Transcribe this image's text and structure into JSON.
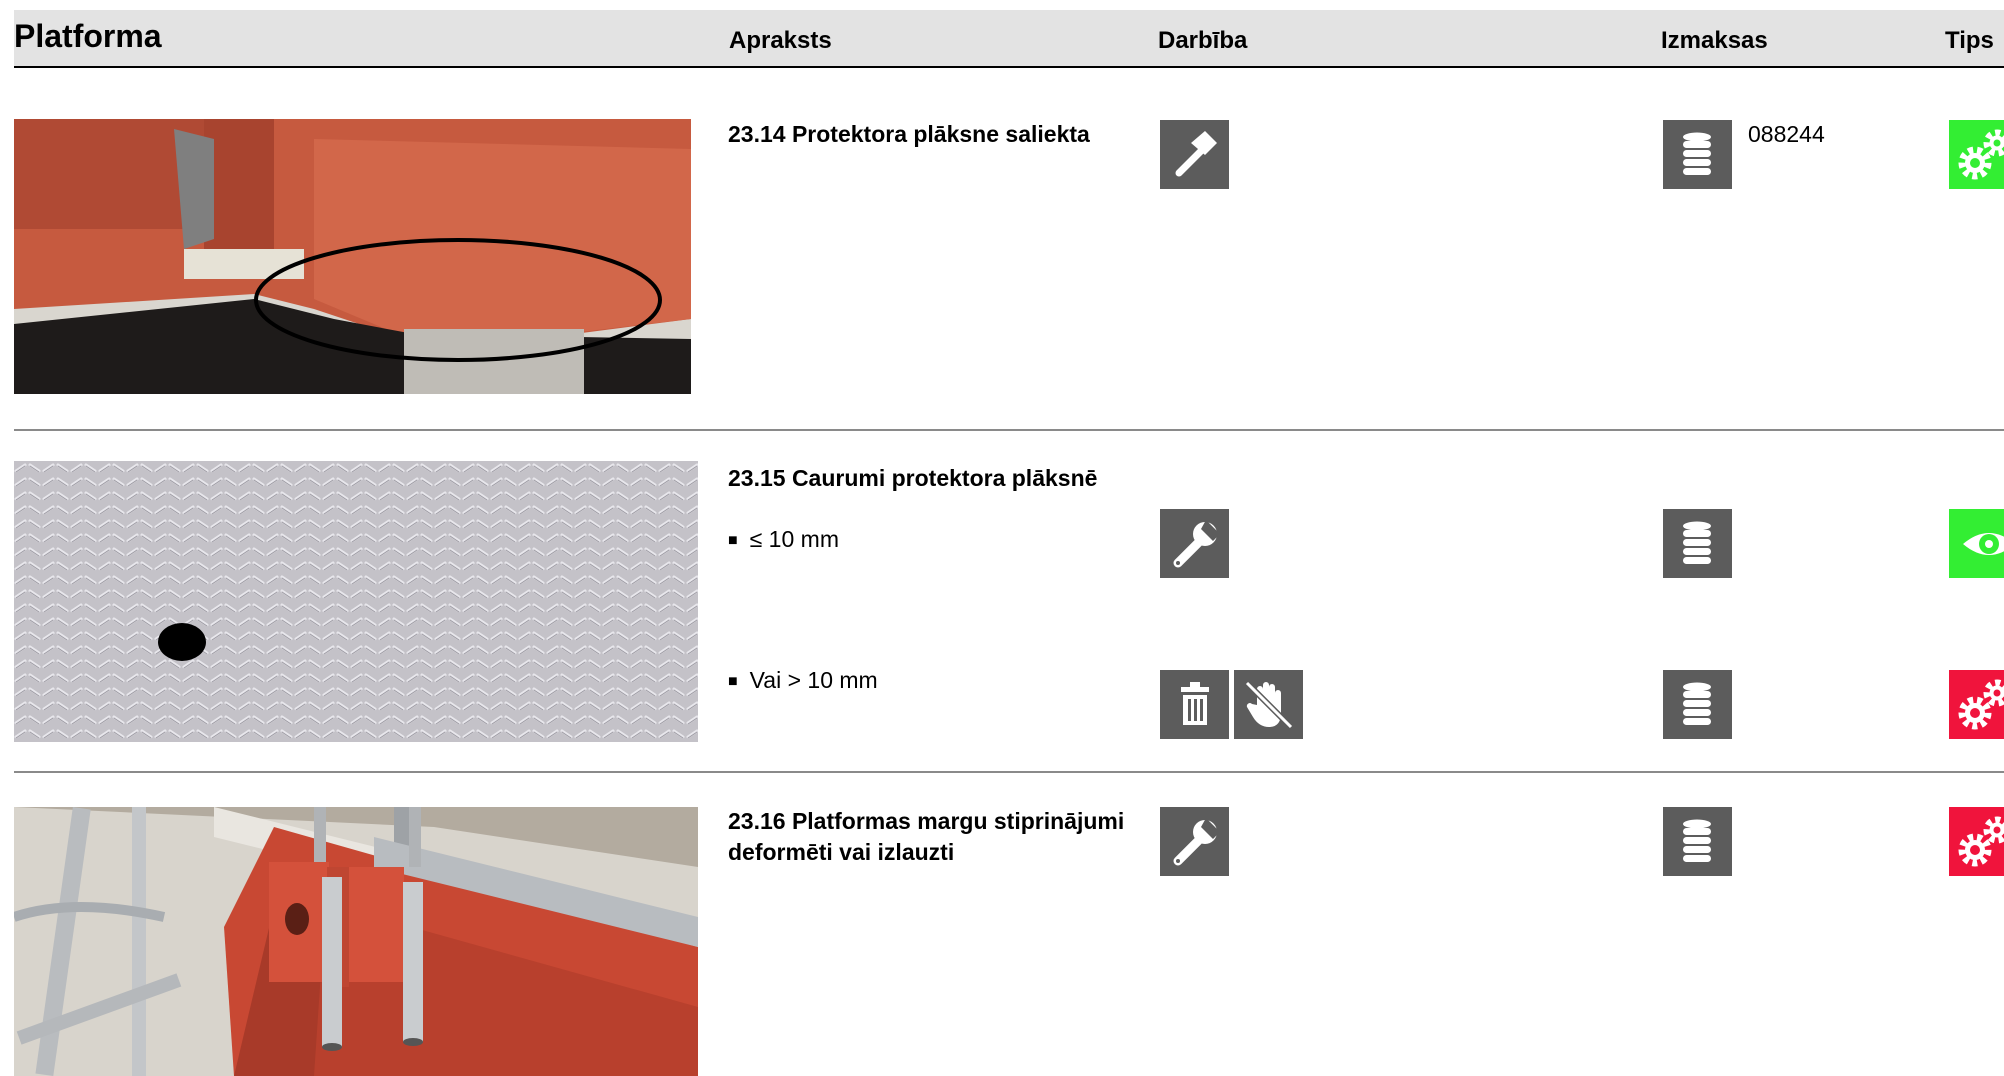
{
  "header": {
    "title": "Platforma",
    "col_description": "Apraksts",
    "col_action": "Darbība",
    "col_cost": "Izmaksas",
    "col_tip": "Tips"
  },
  "rows": [
    {
      "title": "23.14 Protektora plāksne saliekta",
      "photo": "bent-tread-plate-photo",
      "action_icons": [
        "hammer-icon"
      ],
      "cost_value": "088244",
      "tip_icon": "gears-icon",
      "tip_color": "#33ee33"
    },
    {
      "title": "23.15 Caurumi protektora plāksnē",
      "photo": "tread-plate-hole-photo",
      "options": [
        {
          "label": "≤ 10 mm",
          "action_icons": [
            "wrench-icon"
          ],
          "tip_icon": "eye-icon",
          "tip_color": "#33ee33"
        },
        {
          "label": "Vai > 10 mm",
          "action_icons": [
            "trash-icon",
            "no-hand-icon"
          ],
          "tip_icon": "gears-icon",
          "tip_color": "#f0143c"
        }
      ]
    },
    {
      "title_line1": "23.16 Platformas margu stiprinājumi",
      "title_line2": "deformēti vai izlauzti",
      "photo": "railing-mount-photo",
      "action_icons": [
        "wrench-icon"
      ],
      "tip_icon": "gears-icon",
      "tip_color": "#f0143c"
    }
  ],
  "icons": {
    "cost": "coins-icon"
  },
  "colors": {
    "icon_bg": "#5c5c5c",
    "header_bg": "#e3e3e3",
    "ok_green": "#33ee33",
    "replace_red": "#f0143c"
  }
}
